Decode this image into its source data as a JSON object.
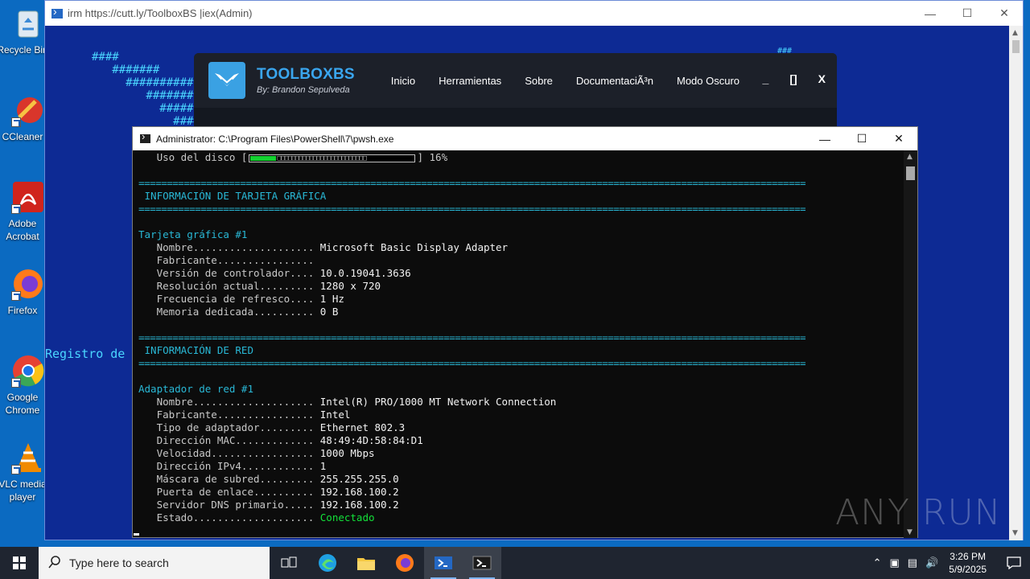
{
  "desktop": {
    "icons": [
      {
        "label": "Recycle Bin",
        "icon": "recycle-bin-icon"
      },
      {
        "label": "CCleaner",
        "icon": "ccleaner-icon"
      },
      {
        "label": "Adobe Acrobat",
        "icon": "acrobat-icon"
      },
      {
        "label": "Firefox",
        "icon": "firefox-icon"
      },
      {
        "label": "Google Chrome",
        "icon": "chrome-icon"
      },
      {
        "label": "VLC media player",
        "icon": "vlc-icon"
      }
    ]
  },
  "back_window": {
    "title": "irm https://cutt.ly/ToolboxBS |iex(Admin)",
    "ascii_art": "####\n   #######\n     ##########\n        #######\n          #####\n            ####",
    "ascii_right": "###",
    "registro_text": "Registro de"
  },
  "toolbox": {
    "brand": "TOOLBOXBS",
    "byline": "By: Brandon Sepulveda",
    "nav": [
      "Inicio",
      "Herramientas",
      "Sobre",
      "DocumentaciÃ³n",
      "Modo Oscuro"
    ],
    "controls": {
      "minimize": "_",
      "maximize": "[]",
      "close": "X"
    }
  },
  "terminal": {
    "title": "Administrator: C:\\Program Files\\PowerShell\\7\\pwsh.exe",
    "disk_label": "Uso del disco [",
    "disk_bar_end": "] 16%",
    "disk_percent": 16,
    "separator": "======================================================================================================================",
    "gpu_section": " INFORMACIÓN DE TARJETA GRÁFICA",
    "gpu_header": "Tarjeta gráfica #1",
    "gpu_rows": [
      {
        "label": "   Nombre.................... ",
        "value": "Microsoft Basic Display Adapter"
      },
      {
        "label": "   Fabricante................ ",
        "value": ""
      },
      {
        "label": "   Versión de controlador.... ",
        "value": "10.0.19041.3636"
      },
      {
        "label": "   Resolución actual......... ",
        "value": "1280 x 720"
      },
      {
        "label": "   Frecuencia de refresco.... ",
        "value": "1 Hz"
      },
      {
        "label": "   Memoria dedicada.......... ",
        "value": "0 B"
      }
    ],
    "net_section": " INFORMACIÓN DE RED",
    "net_header": "Adaptador de red #1",
    "net_rows": [
      {
        "label": "   Nombre.................... ",
        "value": "Intel(R) PRO/1000 MT Network Connection"
      },
      {
        "label": "   Fabricante................ ",
        "value": "Intel"
      },
      {
        "label": "   Tipo de adaptador......... ",
        "value": "Ethernet 802.3"
      },
      {
        "label": "   Dirección MAC............. ",
        "value": "48:49:4D:58:84:D1"
      },
      {
        "label": "   Velocidad................. ",
        "value": "1000 Mbps"
      },
      {
        "label": "   Dirección IPv4............ ",
        "value": "1"
      },
      {
        "label": "   Máscara de subred......... ",
        "value": "255.255.255.0"
      },
      {
        "label": "   Puerta de enlace.......... ",
        "value": "192.168.100.2"
      },
      {
        "label": "   Servidor DNS primario..... ",
        "value": "192.168.100.2"
      },
      {
        "label": "   Estado.................... ",
        "value": "Conectado"
      }
    ]
  },
  "watermark": "ANY RUN",
  "taskbar": {
    "search_placeholder": "Type here to search",
    "time": "3:26 PM",
    "date": "5/9/2025"
  },
  "colors": {
    "accent_cyan": "#29b8d6",
    "status_green": "#13e13a",
    "toolbox_blue": "#3aa6ef"
  }
}
